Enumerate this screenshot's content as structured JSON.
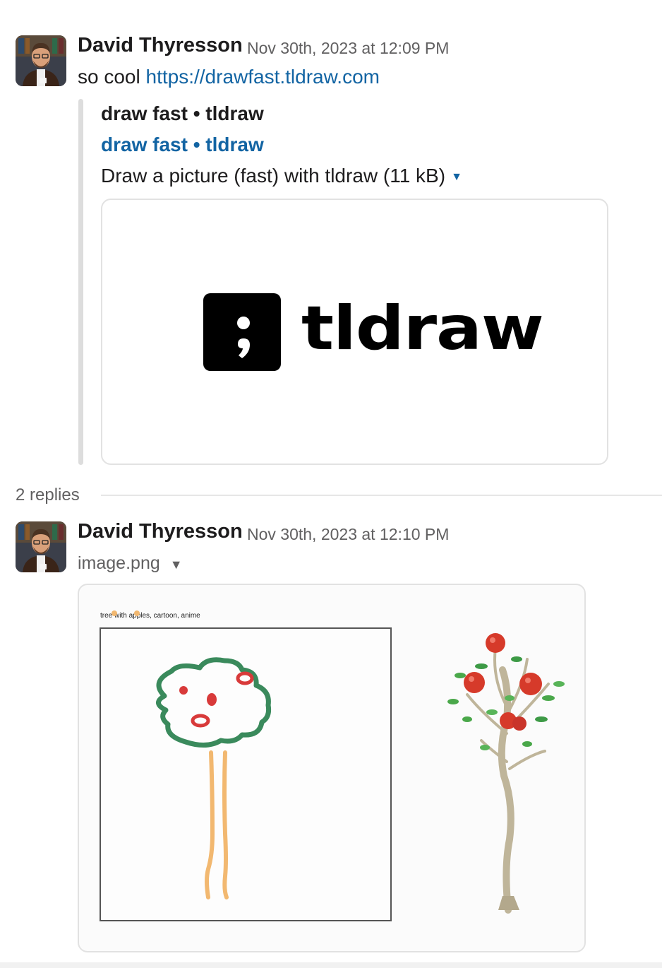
{
  "messages": [
    {
      "author": "David Thyresson",
      "timestamp": "Nov 30th, 2023 at 12:09 PM",
      "text_prefix": "so cool ",
      "link_text": "https://drawfast.tldraw.com",
      "unfurl": {
        "site_name": "draw fast • tldraw",
        "title": "draw fast • tldraw",
        "description": "Draw a picture (fast) with tldraw (11 kB)",
        "logo_word": "tldraw"
      }
    },
    {
      "author": "David Thyresson",
      "timestamp": "Nov 30th, 2023 at 12:10 PM",
      "file_name": "image.png",
      "image": {
        "prompt": "tree with apples, cartoon, anime"
      }
    }
  ],
  "thread": {
    "replies_label": "2 replies"
  },
  "icons": {
    "avatar": "avatar-photo",
    "collapse": "caret-down-icon"
  },
  "colors": {
    "link": "#1264a3",
    "meta": "#616061",
    "sketch_green": "#3a8a5c",
    "sketch_red": "#d83a3a",
    "sketch_orange": "#f2b870"
  }
}
